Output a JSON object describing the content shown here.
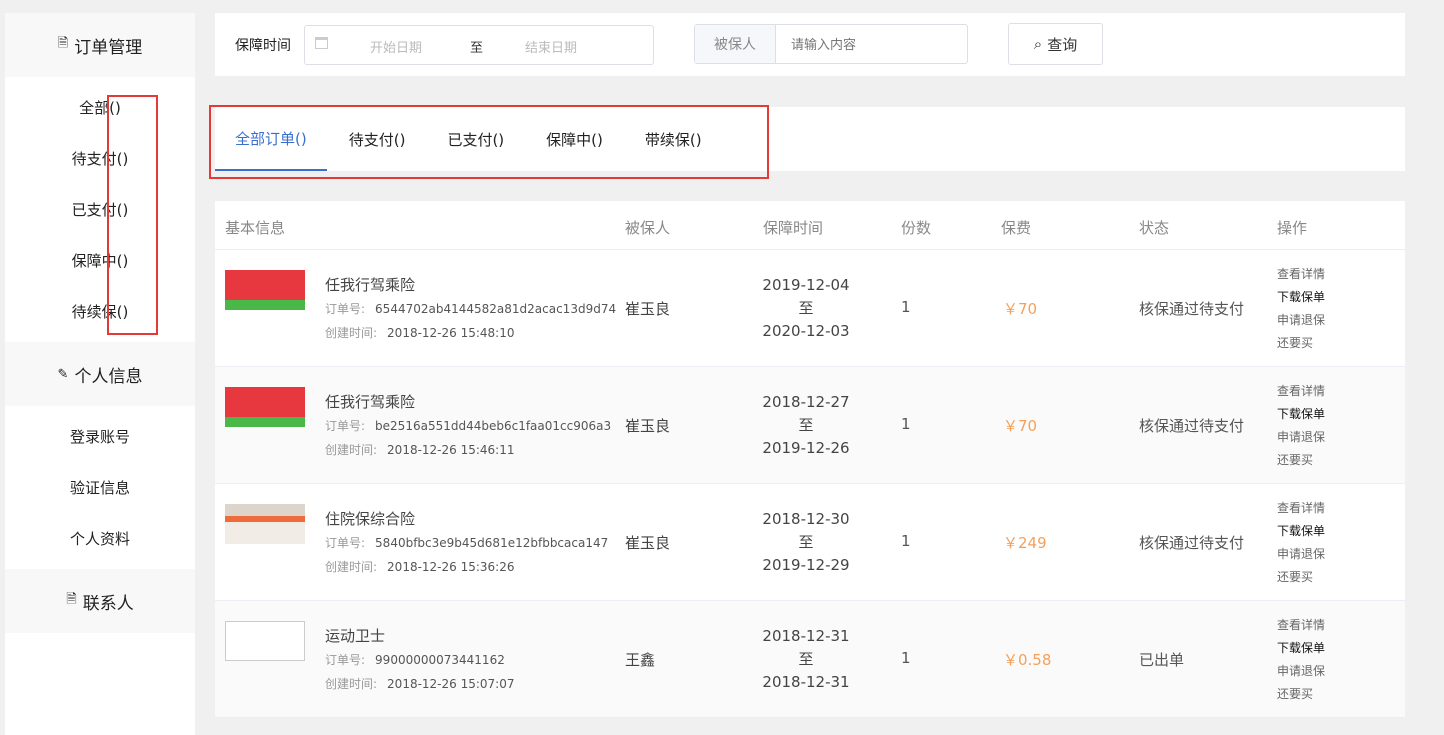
{
  "sidebar": {
    "sections": [
      {
        "title": "订单管理",
        "icon": "document-icon",
        "items": [
          "全部()",
          "待支付()",
          "已支付()",
          "保障中()",
          "待续保()"
        ]
      },
      {
        "title": "个人信息",
        "icon": "edit-icon",
        "items": [
          "登录账号",
          "验证信息",
          "个人资料"
        ]
      },
      {
        "title": "联系人",
        "icon": "document-icon",
        "items": []
      }
    ]
  },
  "filter": {
    "label": "保障时间",
    "start_placeholder": "开始日期",
    "separator": "至",
    "end_placeholder": "结束日期",
    "insured_label": "被保人",
    "insured_placeholder": "请输入内容",
    "query_label": "查询"
  },
  "tabs": [
    "全部订单()",
    "待支付()",
    "已支付()",
    "保障中()",
    "带续保()"
  ],
  "table": {
    "headers": [
      "基本信息",
      "被保人",
      "保障时间",
      "份数",
      "保费",
      "状态",
      "操作"
    ],
    "order_label": "订单号:",
    "created_label": "创建时间:",
    "to": "至",
    "actions": [
      "查看详情",
      "下载保单",
      "申请退保",
      "还要买"
    ],
    "rows": [
      {
        "product": "任我行驾乘险",
        "order_no": "6544702ab4144582a81d2acac13d9d74",
        "created": "2018-12-26 15:48:10",
        "insured": "崔玉良",
        "start": "2019-12-04",
        "end": "2020-12-03",
        "qty": "1",
        "premium": "￥70",
        "status": "核保通过待支付",
        "img": "car"
      },
      {
        "product": "任我行驾乘险",
        "order_no": "be2516a551dd44beb6c1faa01cc906a3",
        "created": "2018-12-26 15:46:11",
        "insured": "崔玉良",
        "start": "2018-12-27",
        "end": "2019-12-26",
        "qty": "1",
        "premium": "￥70",
        "status": "核保通过待支付",
        "img": "car"
      },
      {
        "product": "住院保综合险",
        "order_no": "5840bfbc3e9b45d681e12bfbbcaca147",
        "created": "2018-12-26 15:36:26",
        "insured": "崔玉良",
        "start": "2018-12-30",
        "end": "2019-12-29",
        "qty": "1",
        "premium": "￥249",
        "status": "核保通过待支付",
        "img": "hospital"
      },
      {
        "product": "运动卫士",
        "order_no": "99000000073441162",
        "created": "2018-12-26 15:07:07",
        "insured": "王鑫",
        "start": "2018-12-31",
        "end": "2018-12-31",
        "qty": "1",
        "premium": "￥0.58",
        "status": "已出单",
        "img": "empty"
      }
    ]
  }
}
